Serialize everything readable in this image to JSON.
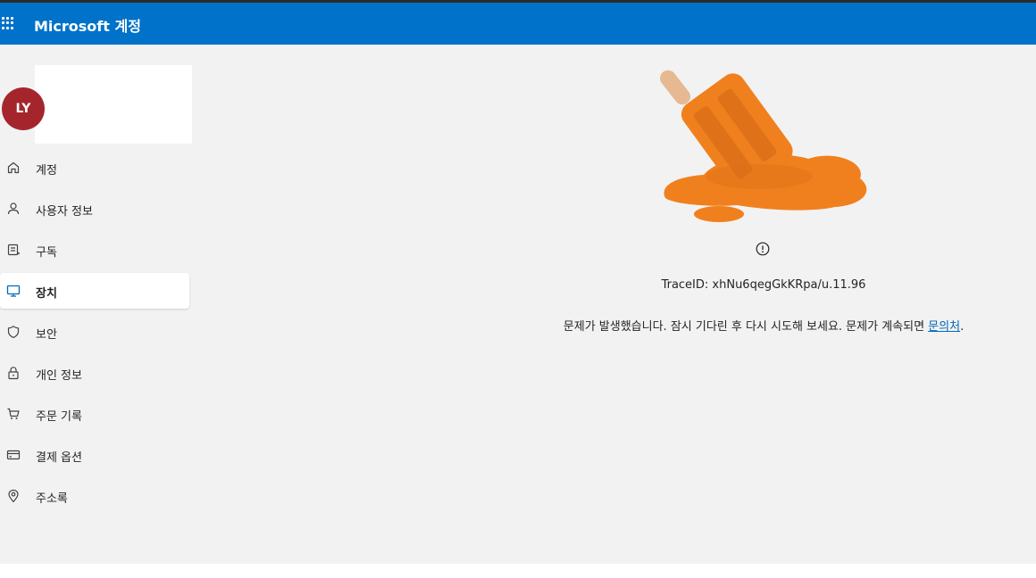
{
  "header": {
    "app_title": "Microsoft 계정"
  },
  "profile": {
    "initials": "LY",
    "avatar_color": "#a4262c"
  },
  "nav": {
    "items": [
      {
        "label": "계정",
        "icon": "home-icon"
      },
      {
        "label": "사용자 정보",
        "icon": "person-icon"
      },
      {
        "label": "구독",
        "icon": "subscription-icon"
      },
      {
        "label": "장치",
        "icon": "monitor-icon",
        "active": true
      },
      {
        "label": "보안",
        "icon": "shield-icon"
      },
      {
        "label": "개인 정보",
        "icon": "lock-icon"
      },
      {
        "label": "주문 기록",
        "icon": "cart-icon"
      },
      {
        "label": "결제 옵션",
        "icon": "credit-card-icon"
      },
      {
        "label": "주소록",
        "icon": "location-pin-icon"
      }
    ]
  },
  "error": {
    "trace_id": "TraceID: xhNu6qegGkKRpa/u.11.96",
    "message": "문제가 발생했습니다. 잠시 기다린 후 다시 시도해 보세요. 문제가 계속되면 ",
    "link_text": "문의처",
    "message_end": "."
  },
  "colors": {
    "header": "#0072c9",
    "accent": "#0067b8",
    "background": "#f2f2f2",
    "illustration": "#f0801e"
  }
}
